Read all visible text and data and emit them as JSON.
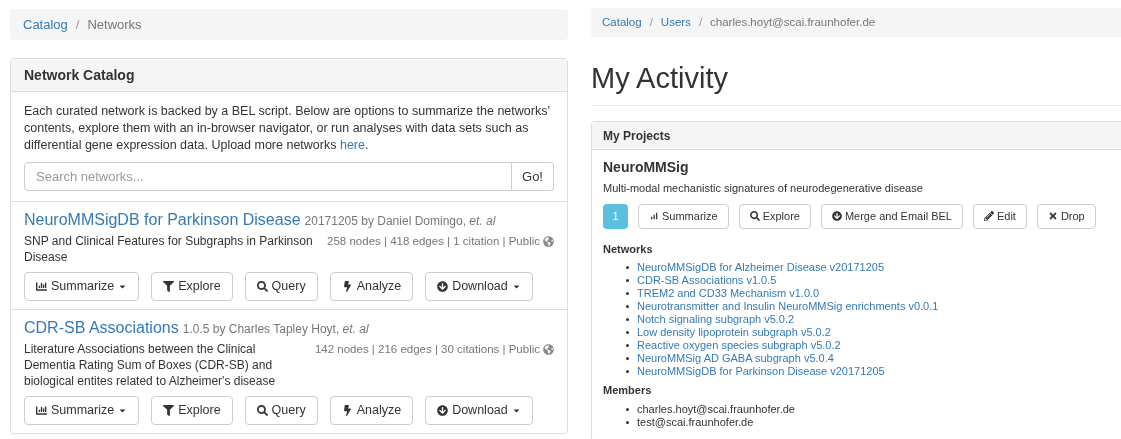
{
  "separator": "/",
  "left": {
    "breadcrumb": [
      {
        "label": "Catalog",
        "link": true
      },
      {
        "label": "Networks",
        "link": false
      }
    ],
    "panel": {
      "title": "Network Catalog",
      "intro": "Each curated network is backed by a BEL script. Below are options to summarize the networks' contents, explore them with an in-browser navigator, or run analyses with data sets such as differential gene expression data. Upload more networks",
      "intro_link": "here",
      "intro_end": ".",
      "search": {
        "placeholder": "Search networks...",
        "button": "Go!"
      },
      "networks": [
        {
          "name": "NeuroMMSigDB for Parkinson Disease",
          "byline": "20171205 by Daniel Domingo, *et. al*",
          "description": "SNP and Clinical Features for Subgraphs in Parkinson Disease",
          "stats": "258 nodes | 418 edges | 1 citation | Public",
          "buttons": [
            {
              "kind": "chart",
              "label": "Summarize",
              "dropdown": true
            },
            {
              "kind": "filter",
              "label": "Explore",
              "dropdown": false
            },
            {
              "kind": "search",
              "label": "Query",
              "dropdown": false
            },
            {
              "kind": "bolt",
              "label": "Analyze",
              "dropdown": false
            },
            {
              "kind": "download",
              "label": "Download",
              "dropdown": true
            }
          ]
        },
        {
          "name": "CDR-SB Associations",
          "byline": "1.0.5 by Charles Tapley Hoyt, *et. al*",
          "description": "Literature Associations between the Clinical Dementia Rating Sum of Boxes (CDR-SB) and biological entites related to Alzheimer's disease",
          "stats": "142 nodes | 216 edges | 30 citations | Public",
          "buttons": [
            {
              "kind": "chart",
              "label": "Summarize",
              "dropdown": true
            },
            {
              "kind": "filter",
              "label": "Explore",
              "dropdown": false
            },
            {
              "kind": "search",
              "label": "Query",
              "dropdown": false
            },
            {
              "kind": "bolt",
              "label": "Analyze",
              "dropdown": false
            },
            {
              "kind": "download",
              "label": "Download",
              "dropdown": true
            }
          ]
        }
      ]
    }
  },
  "right": {
    "breadcrumb": [
      {
        "label": "Catalog",
        "link": true
      },
      {
        "label": "Users",
        "link": true
      },
      {
        "label": "charles.hoyt@scai.fraunhofer.de",
        "link": false
      }
    ],
    "heading": "My Activity",
    "panel": {
      "title": "My Projects",
      "project": {
        "name": "NeuroMMSig",
        "description": "Multi-modal mechanistic signatures of neurodegenerative disease",
        "count": "1",
        "buttons": [
          {
            "kind": "chart",
            "label": "Summarize"
          },
          {
            "kind": "search",
            "label": "Explore"
          },
          {
            "kind": "download",
            "label": "Merge and Email BEL"
          },
          {
            "kind": "pencil",
            "label": "Edit"
          },
          {
            "kind": "cross",
            "label": "Drop"
          }
        ],
        "networks_title": "Networks",
        "networks": [
          "NeuroMMSigDB for Alzheimer Disease v20171205",
          "CDR-SB Associations v1.0.5",
          "TREM2 and CD33 Mechanism v1.0.0",
          "Neurotransmitter and Insulin NeuroMMSig enrichments v0.0.1",
          "Notch signaling subgraph v5.0.2",
          "Low density lipoprotein subgraph v5.0.2",
          "Reactive oxygen species subgraph v5.0.2",
          "NeuroMMSig AD GABA subgraph v5.0.4",
          "NeuroMMSigDB for Parkinson Disease v20171205"
        ],
        "members_title": "Members",
        "members": [
          "charles.hoyt@scai.fraunhofer.de",
          "test@scai.fraunhofer.de"
        ]
      }
    }
  }
}
